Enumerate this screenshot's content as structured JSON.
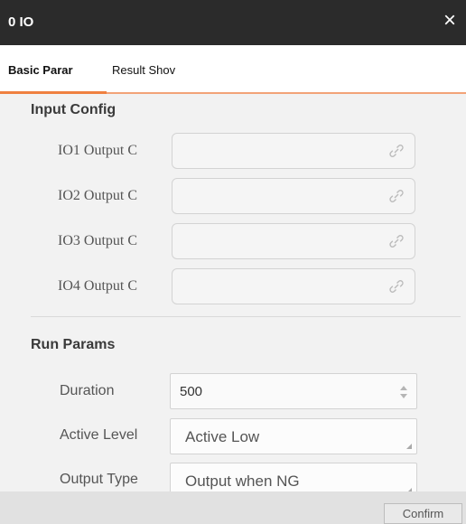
{
  "window": {
    "title": "0 IO"
  },
  "tabs": [
    {
      "label": "Basic Parar",
      "active": true
    },
    {
      "label": "Result Shov",
      "active": false
    }
  ],
  "input_config": {
    "heading": "Input Config",
    "fields": [
      {
        "label": "IO1 Output C",
        "value": ""
      },
      {
        "label": "IO2 Output C",
        "value": ""
      },
      {
        "label": "IO3 Output C",
        "value": ""
      },
      {
        "label": "IO4 Output C",
        "value": ""
      }
    ]
  },
  "run_params": {
    "heading": "Run Params",
    "duration": {
      "label": "Duration",
      "value": "500"
    },
    "active_level": {
      "label": "Active Level",
      "value": "Active Low"
    },
    "output_type": {
      "label": "Output Type",
      "value": "Output when NG"
    }
  },
  "footer": {
    "confirm_label": "Confirm"
  },
  "colors": {
    "accent": "#ef8040",
    "titlebar": "#2b2b2b"
  },
  "icons": {
    "close": "close-icon",
    "link": "link-icon",
    "spinner": "spinner-arrows-icon"
  }
}
